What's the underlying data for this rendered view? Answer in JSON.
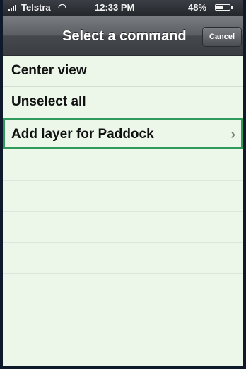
{
  "status_bar": {
    "carrier": "Telstra",
    "time": "12:33 PM",
    "battery_percent": "48%",
    "battery_level": 0.48,
    "signal_icon": "signal-bars-icon",
    "wifi_icon": "wifi-icon",
    "battery_icon": "battery-icon"
  },
  "nav_bar": {
    "title": "Select a command",
    "cancel_label": "Cancel"
  },
  "commands": [
    {
      "label": "Center view",
      "selected": false
    },
    {
      "label": "Unselect all",
      "selected": false
    },
    {
      "label": "Add layer for Paddock",
      "selected": true,
      "disclosure_icon": "chevron-right-icon"
    }
  ],
  "colors": {
    "list_background": "#ecf7ea",
    "selection_border": "#2f9a5c"
  }
}
